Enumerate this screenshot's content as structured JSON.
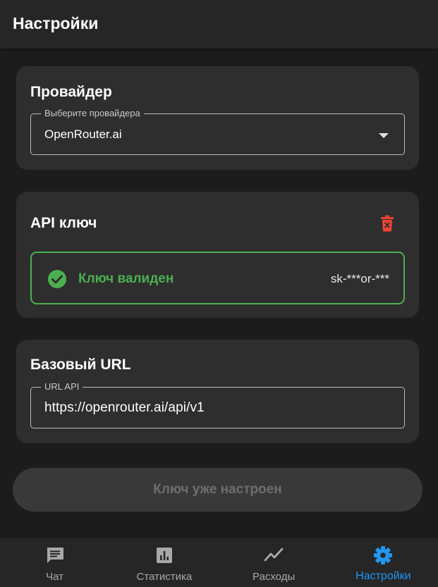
{
  "appbar": {
    "title": "Настройки"
  },
  "provider_card": {
    "title": "Провайдер",
    "field_legend": "Выберите провайдера",
    "selected_value": "OpenRouter.ai"
  },
  "api_key_card": {
    "title": "API ключ",
    "status_text": "Ключ валиден",
    "masked_key": "sk-***or-***"
  },
  "base_url_card": {
    "title": "Базовый URL",
    "field_legend": "URL API",
    "value": "https://openrouter.ai/api/v1"
  },
  "submit_button": {
    "label": "Ключ уже настроен"
  },
  "bottom_nav": {
    "items": [
      {
        "label": "Чат",
        "icon": "chat-icon"
      },
      {
        "label": "Статистика",
        "icon": "bar-chart-icon"
      },
      {
        "label": "Расходы",
        "icon": "trend-line-icon"
      },
      {
        "label": "Настройки",
        "icon": "gear-icon",
        "active": true
      }
    ]
  },
  "colors": {
    "background": "#1c1c1c",
    "card": "#2e2e2e",
    "success": "#4caf50",
    "danger": "#f44336",
    "accent": "#2196f3"
  }
}
